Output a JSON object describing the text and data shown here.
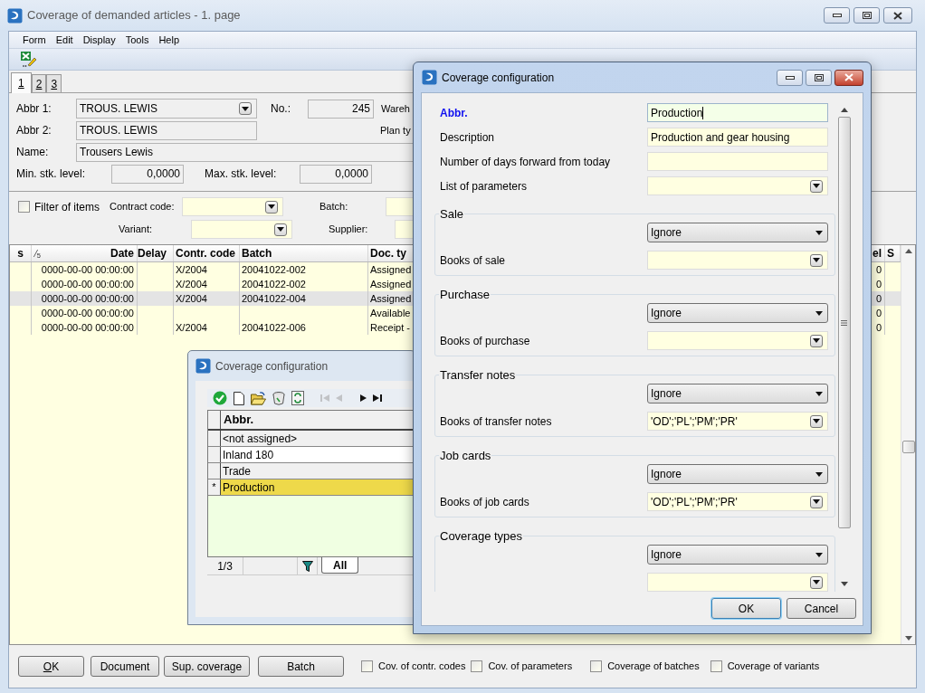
{
  "window": {
    "title": "Coverage of demanded articles - 1. page",
    "active": false
  },
  "menu": [
    "Form",
    "Edit",
    "Display",
    "Tools",
    "Help"
  ],
  "tabs": [
    {
      "label": "1",
      "selected": true
    },
    {
      "label": "2",
      "selected": false
    },
    {
      "label": "3",
      "selected": false
    }
  ],
  "article": {
    "abbr1": {
      "label": "Abbr 1:",
      "value": "TROUS. LEWIS"
    },
    "number": {
      "label": "No.:",
      "value": "245"
    },
    "warehouse_label": "Wareh",
    "abbr2": {
      "label": "Abbr 2:",
      "value": "TROUS. LEWIS"
    },
    "plan_label": "Plan ty",
    "name": {
      "label": "Name:",
      "value": "Trousers Lewis"
    },
    "min_level": {
      "label": "Min. stk. level:",
      "value": "0,0000"
    },
    "max_level": {
      "label": "Max. stk. level:",
      "value": "0,0000"
    }
  },
  "filter": {
    "label": "Filter of items",
    "checked": false,
    "fields": [
      {
        "label": "Contract code:",
        "kind": "combo"
      },
      {
        "label": "Batch:",
        "kind": "text"
      },
      {
        "label": "Variant:",
        "kind": "combo"
      },
      {
        "label": "Supplier:",
        "kind": "text"
      }
    ]
  },
  "table": {
    "columns": [
      {
        "label": "s"
      },
      {
        "label": "Date",
        "sort_mark": "⁄$_{5}$"
      },
      {
        "label": "Delay"
      },
      {
        "label": "Contr. code"
      },
      {
        "label": "Batch"
      },
      {
        "label": "Doc. ty"
      },
      {
        "label": "el"
      },
      {
        "label": "S"
      }
    ],
    "rows": [
      {
        "date": "0000-00-00 00:00:00",
        "contract_code": "X/2004",
        "batch": "20041022-002",
        "doc_type": "Assigned",
        "el": "0",
        "selected": false
      },
      {
        "date": "0000-00-00 00:00:00",
        "contract_code": "X/2004",
        "batch": "20041022-002",
        "doc_type": "Assigned",
        "el": "0",
        "selected": false
      },
      {
        "date": "0000-00-00 00:00:00",
        "contract_code": "X/2004",
        "batch": "20041022-004",
        "doc_type": "Assigned",
        "el": "0",
        "selected": true
      },
      {
        "date": "0000-00-00 00:00:00",
        "doc_type": "Available",
        "el": "0",
        "selected": false
      },
      {
        "date": "0000-00-00 00:00:00",
        "contract_code": "X/2004",
        "batch": "20041022-006",
        "doc_type": "Receipt -",
        "el": "0",
        "selected": false
      }
    ]
  },
  "buttons": [
    {
      "label": "OK",
      "accelerator": true
    },
    {
      "label": "Document",
      "accelerator": false
    },
    {
      "label": "Sup. coverage",
      "accelerator": false
    },
    {
      "label": "Batch",
      "accelerator": false
    }
  ],
  "options": [
    {
      "label": "Cov. of contr. codes",
      "checked": false
    },
    {
      "label": "Cov. of parameters",
      "checked": false
    },
    {
      "label": "Coverage of batches",
      "checked": false
    },
    {
      "label": "Coverage of variants",
      "checked": false
    }
  ],
  "list_dialog": {
    "title": "Coverage configuration",
    "active": false,
    "toolbar": [
      {
        "kind": "confirm",
        "disabled": false
      },
      {
        "kind": "new",
        "disabled": false
      },
      {
        "kind": "open",
        "disabled": false
      },
      {
        "kind": "delete",
        "disabled": false
      },
      {
        "kind": "refresh",
        "disabled": false
      },
      {
        "kind": "first",
        "disabled": true
      },
      {
        "kind": "prev",
        "disabled": true
      },
      {
        "kind": "next",
        "disabled": false
      },
      {
        "kind": "last",
        "disabled": false
      }
    ],
    "column": "Abbr.",
    "rows": [
      {
        "abbr": "<not assigned>",
        "selected": false
      },
      {
        "abbr": "Inland 180",
        "selected": false
      },
      {
        "abbr": "Trade",
        "selected": false
      },
      {
        "abbr": "Production",
        "selected": true,
        "marker": "*"
      }
    ],
    "record_count": "1/3",
    "filter_tab": "All"
  },
  "config_dialog": {
    "title": "Coverage configuration",
    "active": true,
    "fields": [
      {
        "label": "Abbr.",
        "value": "Production",
        "kind": "key"
      },
      {
        "label": "Description",
        "value": "Production and gear housing",
        "kind": "text"
      },
      {
        "label": "Number of days forward from today",
        "kind": "text"
      },
      {
        "label": "List of parameters",
        "kind": "combo"
      }
    ],
    "groups": [
      {
        "title": "Sale",
        "mode": "Ignore",
        "books_label": "Books of sale"
      },
      {
        "title": "Purchase",
        "mode": "Ignore",
        "books_label": "Books of purchase"
      },
      {
        "title": "Transfer notes",
        "mode": "Ignore",
        "books_label": "Books of transfer notes",
        "books_value": "'OD';'PL';'PM';'PR'"
      },
      {
        "title": "Job cards",
        "mode": "Ignore",
        "books_label": "Books of job cards",
        "books_value": "'OD';'PL';'PM';'PR'"
      },
      {
        "title": "Coverage types",
        "mode": "Ignore"
      }
    ],
    "buttons": [
      {
        "label": "OK",
        "default": true
      },
      {
        "label": "Cancel",
        "default": false
      }
    ]
  }
}
